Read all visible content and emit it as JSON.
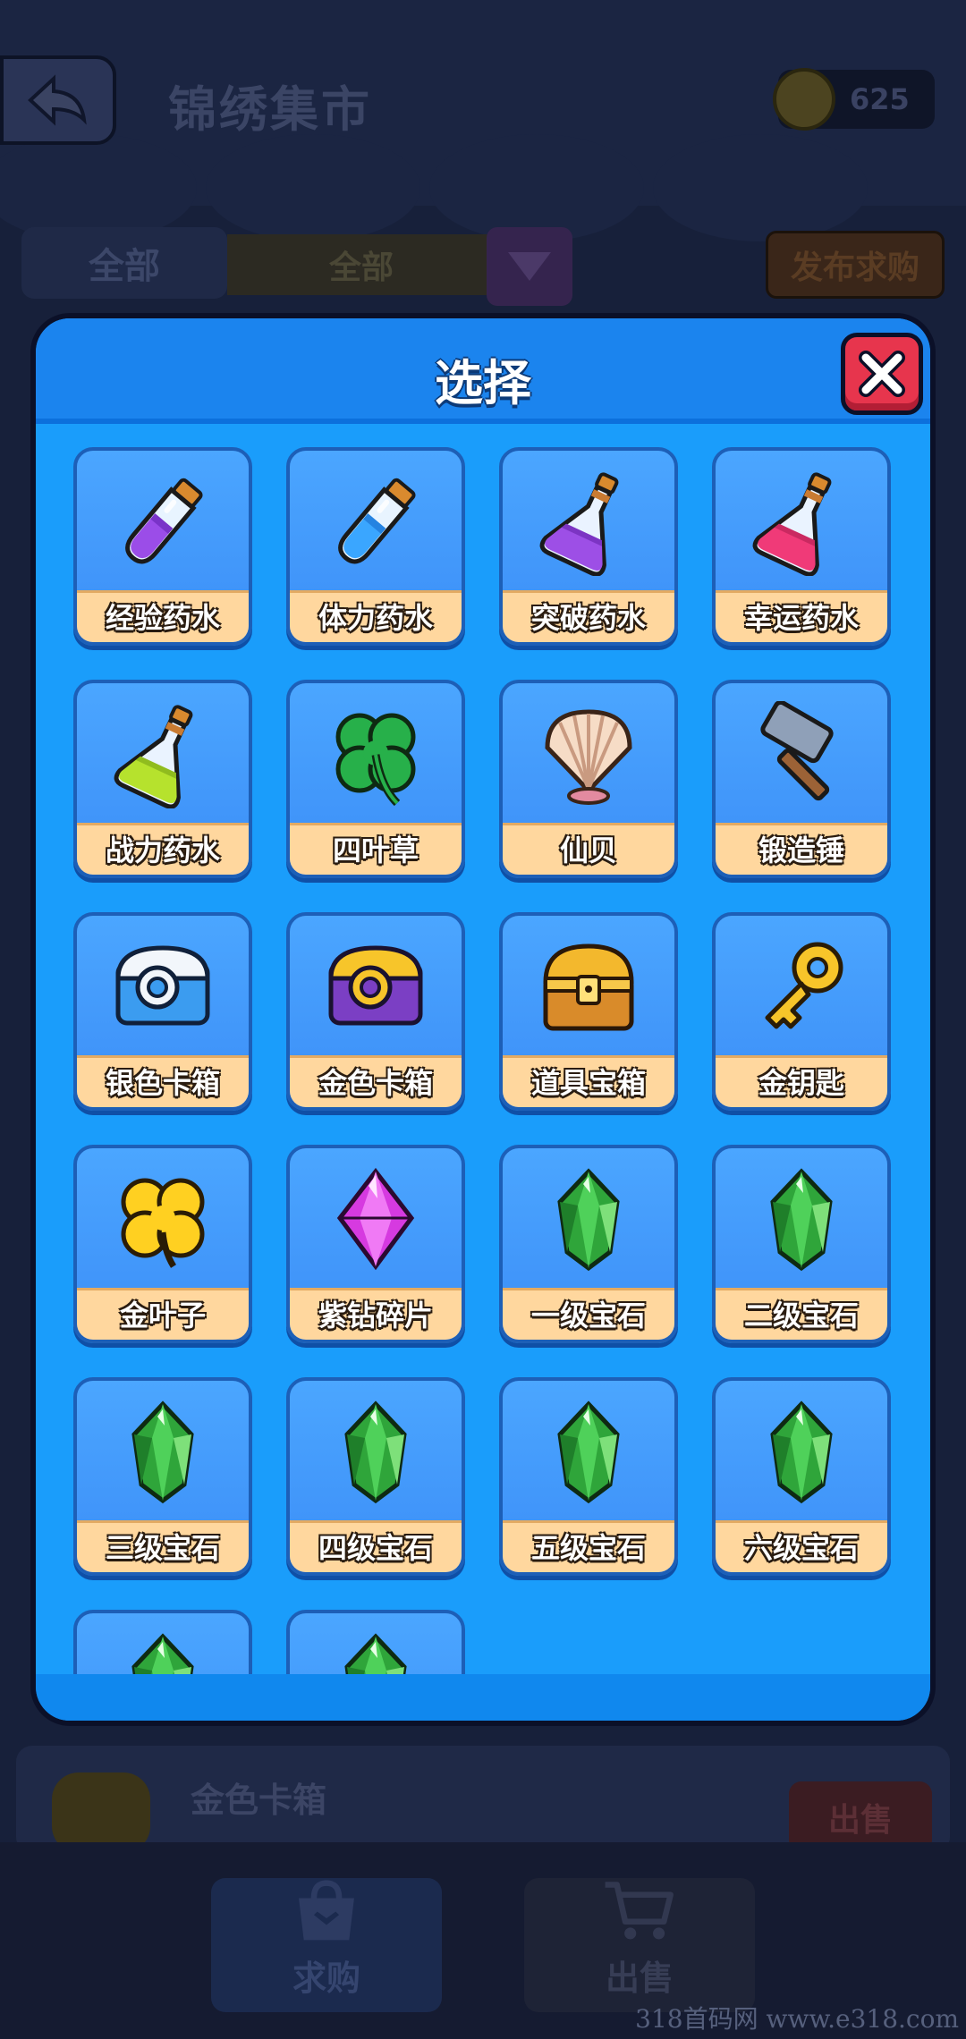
{
  "header": {
    "title": "锦绣集市",
    "coins": "625"
  },
  "filter": {
    "category": "全部",
    "selected": "全部",
    "request_label": "发布求购"
  },
  "listing": {
    "name": "金色卡箱",
    "sell_label": "出售"
  },
  "bottom_nav": {
    "buy_label": "求购",
    "sell_label": "出售"
  },
  "watermark": "318首码网 www.e318.com",
  "modal": {
    "title": "选择",
    "items": [
      {
        "label": "经验药水",
        "icon": "purple-potion-tube"
      },
      {
        "label": "体力药水",
        "icon": "blue-potion-tube"
      },
      {
        "label": "突破药水",
        "icon": "purple-flask"
      },
      {
        "label": "幸运药水",
        "icon": "pink-flask"
      },
      {
        "label": "战力药水",
        "icon": "green-flask"
      },
      {
        "label": "四叶草",
        "icon": "four-leaf-clover"
      },
      {
        "label": "仙贝",
        "icon": "seashell"
      },
      {
        "label": "锻造锤",
        "icon": "hammer"
      },
      {
        "label": "银色卡箱",
        "icon": "silver-card-box"
      },
      {
        "label": "金色卡箱",
        "icon": "gold-card-box"
      },
      {
        "label": "道具宝箱",
        "icon": "treasure-chest"
      },
      {
        "label": "金钥匙",
        "icon": "gold-key"
      },
      {
        "label": "金叶子",
        "icon": "gold-leaf"
      },
      {
        "label": "紫钻碎片",
        "icon": "purple-diamond"
      },
      {
        "label": "一级宝石",
        "icon": "green-gem"
      },
      {
        "label": "二级宝石",
        "icon": "green-gem"
      },
      {
        "label": "三级宝石",
        "icon": "green-gem"
      },
      {
        "label": "四级宝石",
        "icon": "green-gem"
      },
      {
        "label": "五级宝石",
        "icon": "green-gem"
      },
      {
        "label": "六级宝石",
        "icon": "green-gem"
      },
      {
        "label": "",
        "icon": "green-gem"
      },
      {
        "label": "",
        "icon": "green-gem-ornate"
      }
    ]
  },
  "colors": {
    "modal_bg": "#1a9dfb",
    "header_bg": "#1b84ee",
    "tile_bg": "#4ba6ff",
    "label_bg": "#ffd79e",
    "close_red": "#e7354d"
  }
}
